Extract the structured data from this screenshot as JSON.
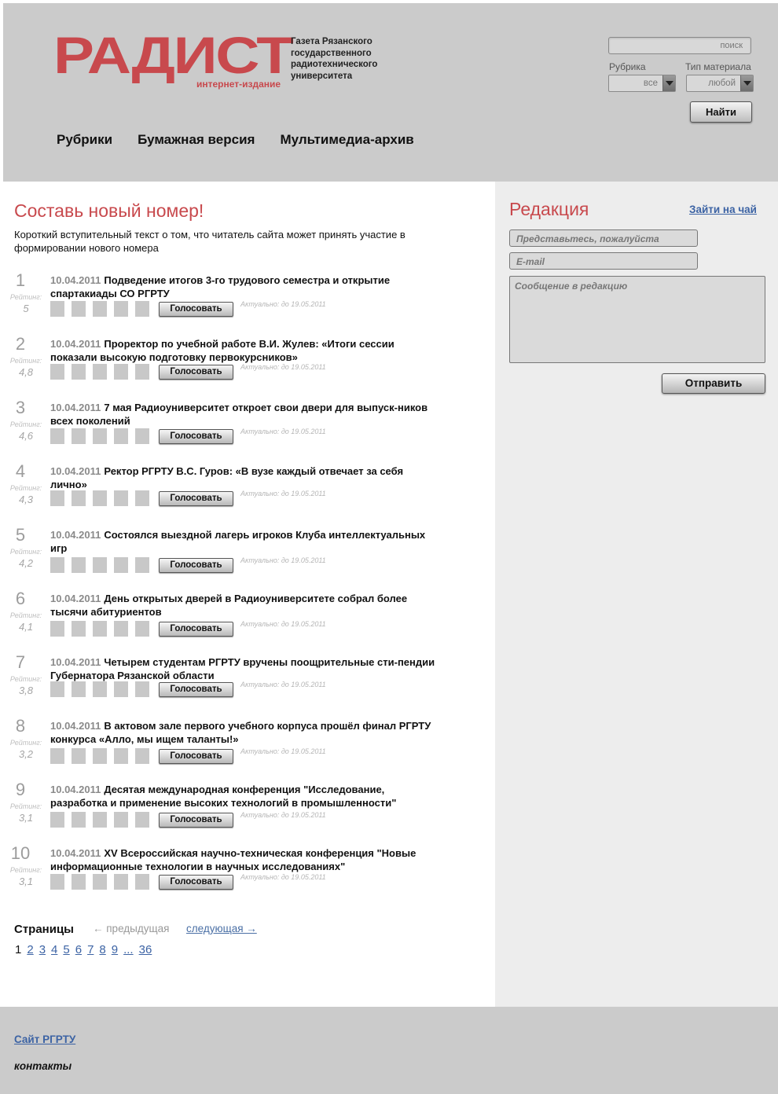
{
  "header": {
    "logo_text": "РАДИСТ",
    "logo_sub": "интернет-издание",
    "tagline": "Газета Рязанского государственного радиотехнического университета",
    "nav": [
      "Рубрики",
      "Бумажная версия",
      "Мультимедиа-архив"
    ]
  },
  "search": {
    "placeholder": "поиск",
    "rubric_label": "Рубрика",
    "rubric_value": "все",
    "type_label": "Тип материала",
    "type_value": "любой",
    "find_label": "Найти"
  },
  "main": {
    "title": "Составь новый номер!",
    "intro": "Короткий вступительный текст о том, что читатель сайта может принять участие в формировании нового номера",
    "rating_label": "Рейтинг:",
    "vote_label": "Голосовать",
    "items": [
      {
        "num": "1",
        "rating": "5",
        "date": "10.04.2011",
        "title": "Подведение итогов 3-го трудового семестра и открытие спартакиады СО РГРТУ",
        "actual": "Актуально: до 19.05.2011"
      },
      {
        "num": "2",
        "rating": "4,8",
        "date": "10.04.2011",
        "title": "Проректор по учебной работе В.И. Жулев: «Итоги сессии показали высокую подготовку первокурсников»",
        "actual": "Актуально: до 19.05.2011"
      },
      {
        "num": "3",
        "rating": "4,6",
        "date": "10.04.2011",
        "title": "7 мая Радиоуниверситет откроет свои двери для выпуск-ников всех поколений",
        "actual": "Актуально: до 19.05.2011"
      },
      {
        "num": "4",
        "rating": "4,3",
        "date": "10.04.2011",
        "title": "Ректор РГРТУ В.С. Гуров: «В вузе каждый отвечает за себя лично»",
        "actual": "Актуально: до 19.05.2011"
      },
      {
        "num": "5",
        "rating": "4,2",
        "date": "10.04.2011",
        "title": "Состоялся выездной лагерь игроков Клуба интеллектуальных игр",
        "actual": "Актуально: до 19.05.2011"
      },
      {
        "num": "6",
        "rating": "4,1",
        "date": "10.04.2011",
        "title": "День открытых дверей в Радиоуниверситете собрал более тысячи абитуриентов",
        "actual": "Актуально: до 19.05.2011"
      },
      {
        "num": "7",
        "rating": "3,8",
        "date": "10.04.2011",
        "title": "Четырем студентам РГРТУ вручены поощрительные сти-пендии Губернатора Рязанской области",
        "actual": "Актуально: до 19.05.2011"
      },
      {
        "num": "8",
        "rating": "3,2",
        "date": "10.04.2011",
        "title": "В актовом зале первого учебного корпуса прошёл финал РГРТУ конкурса «Алло, мы ищем таланты!»",
        "actual": "Актуально: до 19.05.2011"
      },
      {
        "num": "9",
        "rating": "3,1",
        "date": "10.04.2011",
        "title": "Десятая международная конференция \"Исследование, разработка и применение высоких технологий в промышленности\"",
        "actual": "Актуально: до 19.05.2011"
      },
      {
        "num": "10",
        "rating": "3,1",
        "date": "10.04.2011",
        "title": "XV Всероссийская научно-техническая конференция \"Новые информационные технологии в научных исследованиях\"",
        "actual": "Актуально: до 19.05.2011"
      }
    ]
  },
  "pager": {
    "label": "Страницы",
    "prev": "← предыдущая",
    "next": "следующая →",
    "current": "1",
    "pages": [
      "2",
      "3",
      "4",
      "5",
      "6",
      "7",
      "8",
      "9",
      "...",
      "36"
    ]
  },
  "sidebar": {
    "title": "Редакция",
    "tea_link": "Зайти на чай",
    "name_placeholder": "Представьтесь, пожалуйста",
    "email_placeholder": "E-mail",
    "message_placeholder": "Сообщение в редакцию",
    "send_label": "Отправить"
  },
  "footer": {
    "site_link": "Сайт РГРТУ",
    "contacts": "контакты"
  },
  "colors": {
    "accent": "#c8494d",
    "link": "#3c63a4",
    "header_bg": "#cbcbcb",
    "sidebar_bg": "#ededed"
  }
}
